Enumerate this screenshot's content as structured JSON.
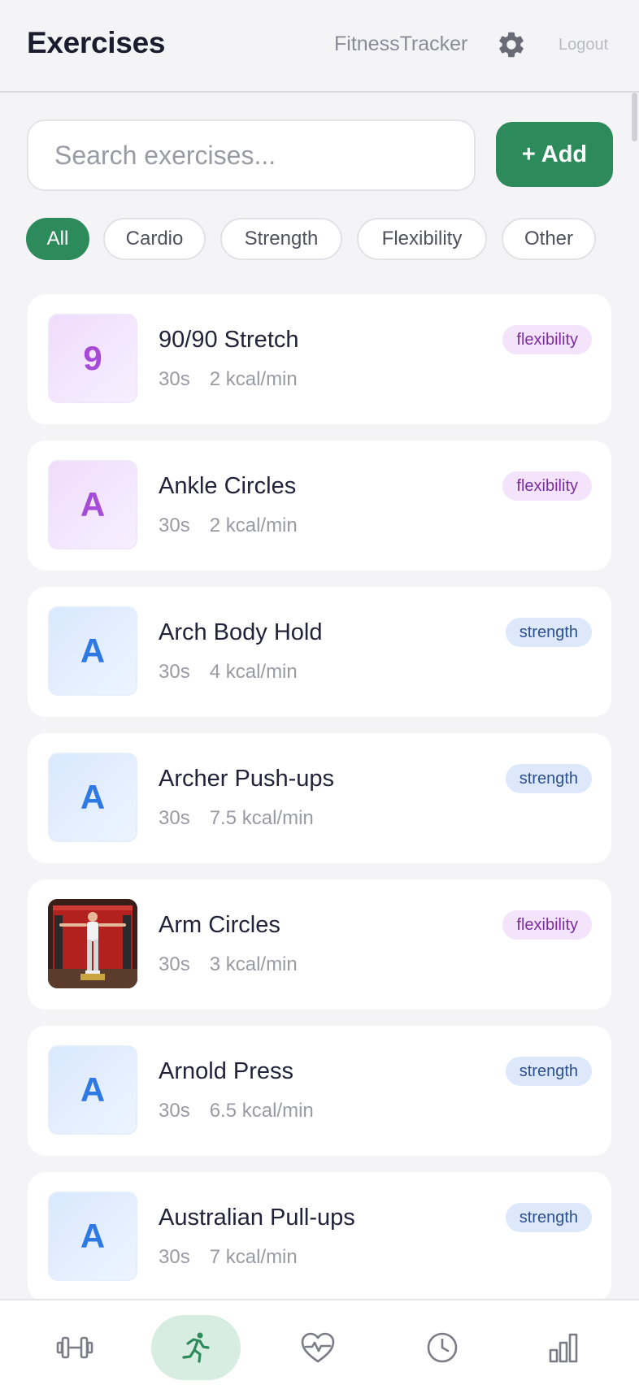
{
  "header": {
    "title": "Exercises",
    "brand": "FitnessTracker",
    "settings_icon": "gear-icon",
    "logout_label": "Logout"
  },
  "search": {
    "placeholder": "Search exercises...",
    "value": ""
  },
  "add_button": {
    "label": "+ Add"
  },
  "filters": [
    {
      "label": "All",
      "active": true
    },
    {
      "label": "Cardio",
      "active": false
    },
    {
      "label": "Strength",
      "active": false
    },
    {
      "label": "Flexibility",
      "active": false
    },
    {
      "label": "Other",
      "active": false
    }
  ],
  "exercises": [
    {
      "initial": "9",
      "name": "90/90 Stretch",
      "duration": "30s",
      "calories": "2 kcal/min",
      "category": "flexibility"
    },
    {
      "initial": "A",
      "name": "Ankle Circles",
      "duration": "30s",
      "calories": "2 kcal/min",
      "category": "flexibility"
    },
    {
      "initial": "A",
      "name": "Arch Body Hold",
      "duration": "30s",
      "calories": "4 kcal/min",
      "category": "strength"
    },
    {
      "initial": "A",
      "name": "Archer Push-ups",
      "duration": "30s",
      "calories": "7.5 kcal/min",
      "category": "strength"
    },
    {
      "initial": "",
      "name": "Arm Circles",
      "duration": "30s",
      "calories": "3 kcal/min",
      "category": "flexibility",
      "has_photo": true
    },
    {
      "initial": "A",
      "name": "Arnold Press",
      "duration": "30s",
      "calories": "6.5 kcal/min",
      "category": "strength"
    },
    {
      "initial": "A",
      "name": "Australian Pull-ups",
      "duration": "30s",
      "calories": "7 kcal/min",
      "category": "strength"
    }
  ],
  "colors": {
    "accent": "#2d8a5b",
    "flexibility_badge_bg": "#f3e3fb",
    "strength_badge_bg": "#dde9fb"
  },
  "bottom_nav": [
    {
      "icon": "dumbbell-icon",
      "active": false
    },
    {
      "icon": "running-icon",
      "active": true
    },
    {
      "icon": "heart-pulse-icon",
      "active": false
    },
    {
      "icon": "clock-icon",
      "active": false
    },
    {
      "icon": "bar-chart-icon",
      "active": false
    }
  ]
}
